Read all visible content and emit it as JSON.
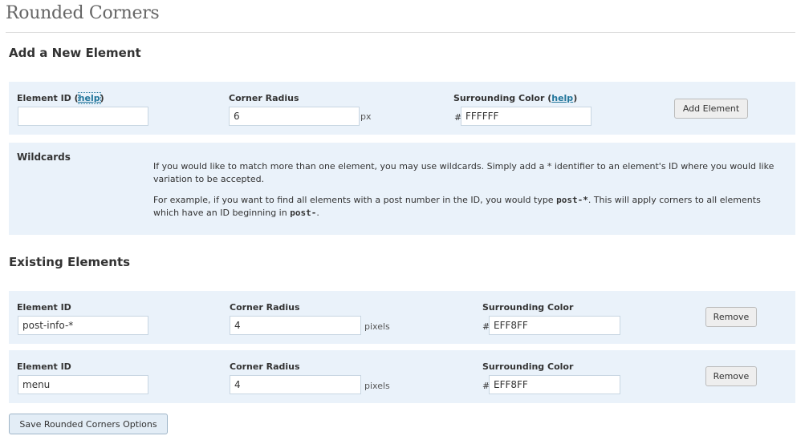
{
  "page": {
    "title": "Rounded Corners"
  },
  "add_section": {
    "heading": "Add a New Element",
    "element_id_label": "Element ID",
    "help_link": "help",
    "element_id_value": "",
    "corner_radius_label": "Corner Radius",
    "corner_radius_value": "6",
    "corner_radius_unit": "px",
    "surrounding_color_label": "Surrounding Color",
    "hash": "#",
    "surrounding_color_value": "FFFFFF",
    "add_button": "Add Element"
  },
  "wildcards": {
    "label": "Wildcards",
    "p1": "If you would like to match more than one element, you may use wildcards. Simply add a * identifier to an element's ID where you would like variation to be accepted.",
    "p2_before": "For example, if you want to find all elements with a post number in the ID, you would type ",
    "p2_code1": "post-*",
    "p2_middle": ". This will apply corners to all elements which have an ID beginning in ",
    "p2_code2": "post-",
    "p2_after": "."
  },
  "existing_section": {
    "heading": "Existing Elements",
    "rows": [
      {
        "element_id_label": "Element ID",
        "element_id_value": "post-info-*",
        "corner_radius_label": "Corner Radius",
        "corner_radius_value": "4",
        "unit": "pixels",
        "surrounding_color_label": "Surrounding Color",
        "hash": "#",
        "surrounding_color_value": "EFF8FF",
        "remove_button": "Remove"
      },
      {
        "element_id_label": "Element ID",
        "element_id_value": "menu",
        "corner_radius_label": "Corner Radius",
        "corner_radius_value": "4",
        "unit": "pixels",
        "surrounding_color_label": "Surrounding Color",
        "hash": "#",
        "surrounding_color_value": "EFF8FF",
        "remove_button": "Remove"
      }
    ]
  },
  "save_button": "Save Rounded Corners Options",
  "colors": {
    "panel_background": "#eaf2fa",
    "link": "#21759b",
    "title": "#666666"
  }
}
